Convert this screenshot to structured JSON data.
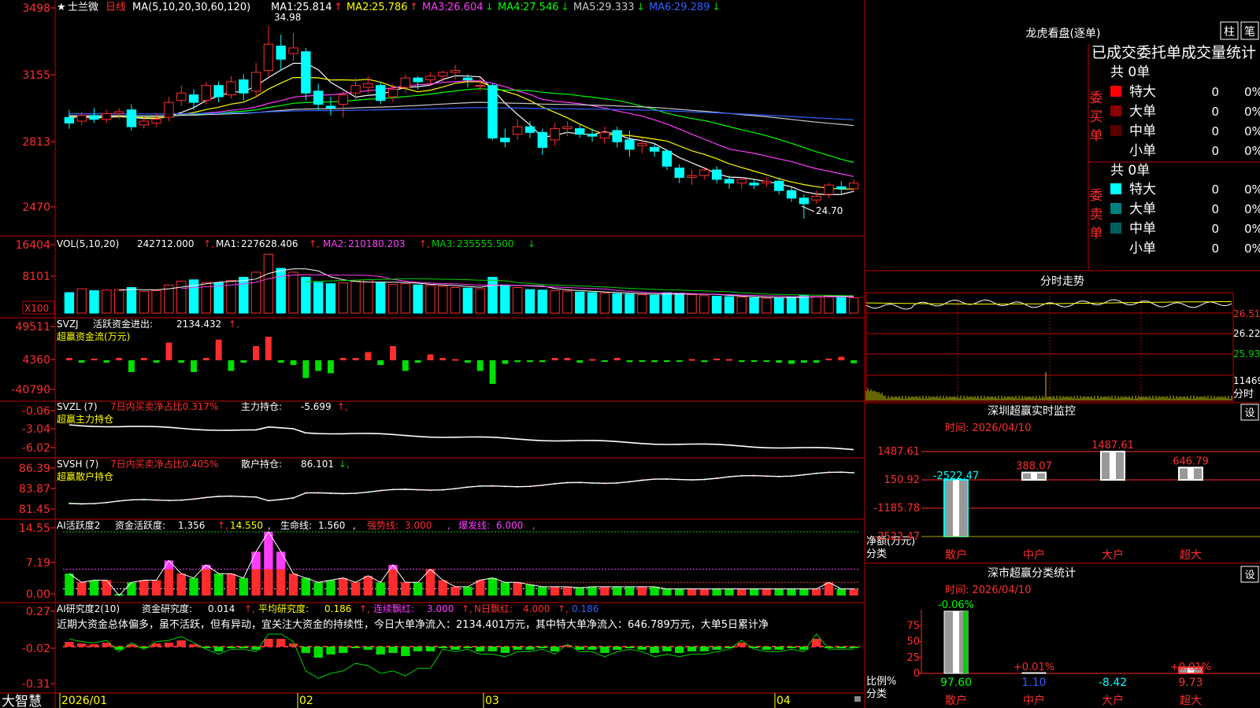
{
  "stock": {
    "name": "士兰微",
    "period": "日线",
    "star": "★",
    "app": "大智慧"
  },
  "colors": {
    "up": "#ff2d2d",
    "down": "#00ffff",
    "bg": "#000000",
    "grid": "#c00000",
    "yellow": "#ffff00",
    "magenta": "#ff3cff",
    "green": "#00d000",
    "blue": "#2a5cff",
    "white": "#ffffff"
  },
  "main_panel": {
    "ma_params": "MA(5,10,20,30,60,120)",
    "ma_values": [
      {
        "label": "MA1:",
        "value": "25.814",
        "arrow": "↑",
        "color": "#ffffff"
      },
      {
        "label": "MA2:",
        "value": "25.786",
        "arrow": "↑",
        "color": "#ffff00"
      },
      {
        "label": "MA3:",
        "value": "26.604",
        "arrow": "↓",
        "color": "#ff3cff"
      },
      {
        "label": "MA4:",
        "value": "27.546",
        "arrow": "↓",
        "color": "#00ff00"
      },
      {
        "label": "MA5:",
        "value": "29.333",
        "arrow": "↓",
        "color": "#c8c8c8"
      },
      {
        "label": "MA6:",
        "value": "29.289",
        "arrow": "↓",
        "color": "#3060ff"
      }
    ],
    "y_ticks": [
      "3498",
      "3155",
      "2813",
      "2470"
    ],
    "high_label": "34.98",
    "low_label": "24.70"
  },
  "vol_panel": {
    "title": "VOL(5,10,20)",
    "value": "242712.000",
    "ma1": "227628.406",
    "ma2": "210180.203",
    "ma3": "235555.500",
    "y_ticks": [
      "16404",
      "8101"
    ],
    "unit": "X100"
  },
  "svzj_panel": {
    "title": "SVZJ",
    "label": "活跃资金进出:",
    "value": "2134.432",
    "subtitle": "超赢资金流(万元)",
    "y_ticks": [
      "49511",
      "4360",
      "-40790"
    ]
  },
  "svzl_panel": {
    "title": "SVZL (7)",
    "ratio_text": "7日内买卖净占比0.317%",
    "hold_label": "主力持仓:",
    "hold_value": "-5.699",
    "subtitle": "超赢主力持仓",
    "y_ticks": [
      "-0.06",
      "-3.04",
      "-6.02"
    ]
  },
  "svsh_panel": {
    "title": "SVSH (7)",
    "ratio_text": "7日内买卖净占比0.405%",
    "hold_label": "散户持仓:",
    "hold_value": "86.101",
    "subtitle": "超赢散户持仓",
    "y_ticks": [
      "86.39",
      "83.87",
      "81.45"
    ]
  },
  "ai_active_panel": {
    "title": "AI活跃度2",
    "label1": "资金活跃度:",
    "value1": "1.356",
    "value2": "14.550",
    "label3": "生命线:",
    "value3": "1.560",
    "label4": "强势线:",
    "value4": "3.000",
    "label5": "爆发线:",
    "value5": "6.000",
    "y_ticks": [
      "14.55",
      "7.19",
      "0.00"
    ]
  },
  "ai_research_panel": {
    "title": "AI研究度2(10)",
    "label1": "资金研究度:",
    "value1": "0.014",
    "label2": "平均研究度:",
    "value2": "0.186",
    "label3": "连续飘红:",
    "value3": "3.000",
    "label4": "N日飘红:",
    "value4": "4.000",
    "value5": "0.186",
    "comment": "近期大资金总体偏多，虽不活跃，但有异动，宜关注大资金的持续性，今日大单净流入：2134.401万元，其中特大单净流入：646.789万元，大单5日累计净",
    "y_ticks": [
      "0.27",
      "-0.02",
      "-0.31"
    ]
  },
  "x_axis": [
    "2026/01",
    "02",
    "03",
    "04"
  ],
  "lhb": {
    "title": "龙虎看盘(逐单)",
    "btn1": "柱",
    "btn2": "笔",
    "header": "已成交委托单成交量统计",
    "buy_label": "委买单",
    "sell_label": "委卖单",
    "buy_total": "共 0单",
    "sell_total": "共 0单",
    "buy_rows": [
      {
        "name": "特大",
        "count": "0",
        "pct": "0%"
      },
      {
        "name": "大单",
        "count": "0",
        "pct": "0%"
      },
      {
        "name": "中单",
        "count": "0",
        "pct": "0%"
      },
      {
        "name": "小单",
        "count": "0",
        "pct": "0%"
      }
    ],
    "sell_rows": [
      {
        "name": "特大",
        "count": "0",
        "pct": "0%"
      },
      {
        "name": "大单",
        "count": "0",
        "pct": "0%"
      },
      {
        "name": "中单",
        "count": "0",
        "pct": "0%"
      },
      {
        "name": "小单",
        "count": "0",
        "pct": "0%"
      }
    ]
  },
  "intraday": {
    "title": "分时走势",
    "prices": [
      "26.51",
      "26.22",
      "25.93"
    ],
    "vol_label": "11469",
    "tab": "分时"
  },
  "monitor": {
    "title": "深圳超赢实时监控",
    "setting": "设",
    "time_label": "时间: 2026/04/10",
    "y_ticks": [
      "1487.61",
      "150.92",
      "-1185.78",
      "-2522.47"
    ],
    "ylabel1": "净额(万元)",
    "ylabel2": "分类",
    "categories": [
      "散户",
      "中户",
      "大户",
      "超大"
    ],
    "values": [
      -2522.47,
      388.07,
      1487.61,
      646.79
    ],
    "value_labels": [
      "-2522.47",
      "388.07",
      "1487.61",
      "646.79"
    ]
  },
  "classify": {
    "title": "深市超赢分类统计",
    "setting": "设",
    "time_label": "时间: 2026/04/10",
    "y_ticks": [
      "75",
      "50",
      "25",
      "0"
    ],
    "ylabel1": "比例%",
    "ylabel2": "分类",
    "categories": [
      "散户",
      "中户",
      "大户",
      "超大"
    ],
    "top_labels": [
      "-0.06%",
      "+0.01%",
      "",
      "+0.01%"
    ],
    "bottom_labels": [
      "97.60",
      "1.10",
      "-8.42",
      "9.73"
    ],
    "values": [
      97.6,
      1.1,
      -8.42,
      9.73
    ]
  },
  "chart_data": [
    {
      "type": "candlestick",
      "title": "士兰微 日线",
      "ylim": [
        24.7,
        34.98
      ],
      "series": [
        {
          "name": "MA1",
          "values": [
            25.814
          ]
        },
        {
          "name": "MA2",
          "values": [
            25.786
          ]
        },
        {
          "name": "MA3",
          "values": [
            26.604
          ]
        },
        {
          "name": "MA4",
          "values": [
            27.546
          ]
        },
        {
          "name": "MA5",
          "values": [
            29.333
          ]
        },
        {
          "name": "MA6",
          "values": [
            29.289
          ]
        }
      ],
      "candles": [
        [
          30.1,
          29.8,
          30.5,
          29.5
        ],
        [
          29.9,
          30.2,
          30.4,
          29.7
        ],
        [
          30.2,
          30.0,
          30.6,
          29.8
        ],
        [
          30.0,
          30.3,
          30.5,
          29.8
        ],
        [
          30.3,
          30.4,
          30.6,
          30.0
        ],
        [
          30.5,
          29.6,
          30.8,
          29.4
        ],
        [
          29.7,
          29.9,
          30.1,
          29.5
        ],
        [
          29.8,
          30.0,
          30.3,
          29.6
        ],
        [
          30.1,
          30.9,
          31.2,
          29.9
        ],
        [
          31.0,
          31.4,
          31.8,
          30.7
        ],
        [
          31.3,
          30.9,
          31.6,
          30.5
        ],
        [
          31.0,
          31.8,
          32.0,
          30.8
        ],
        [
          31.8,
          31.2,
          32.0,
          30.9
        ],
        [
          31.3,
          32.0,
          32.3,
          31.1
        ],
        [
          32.1,
          31.4,
          32.4,
          31.0
        ],
        [
          31.5,
          32.5,
          33.0,
          31.2
        ],
        [
          32.6,
          34.0,
          34.98,
          32.3
        ],
        [
          33.9,
          33.2,
          34.5,
          32.6
        ],
        [
          33.5,
          33.8,
          34.6,
          33.1
        ],
        [
          33.6,
          31.4,
          33.8,
          31.0
        ],
        [
          31.5,
          30.8,
          31.9,
          30.5
        ],
        [
          30.7,
          30.6,
          31.2,
          30.2
        ],
        [
          30.8,
          31.3,
          31.5,
          30.1
        ],
        [
          31.4,
          31.8,
          32.2,
          31.0
        ],
        [
          31.7,
          31.9,
          32.3,
          31.4
        ],
        [
          31.8,
          31.0,
          32.0,
          30.8
        ],
        [
          31.2,
          31.6,
          31.9,
          30.9
        ],
        [
          31.7,
          32.2,
          32.4,
          31.4
        ],
        [
          32.2,
          32.0,
          32.3,
          31.6
        ],
        [
          32.1,
          32.3,
          32.5,
          31.8
        ],
        [
          32.3,
          32.5,
          32.6,
          32.0
        ],
        [
          32.5,
          32.6,
          32.9,
          32.1
        ],
        [
          32.2,
          32.1,
          32.4,
          31.7
        ],
        [
          31.8,
          31.8,
          32.2,
          31.5
        ],
        [
          31.8,
          29.0,
          31.9,
          28.9
        ],
        [
          29.0,
          28.8,
          29.5,
          28.5
        ],
        [
          29.2,
          29.6,
          30.0,
          28.9
        ],
        [
          29.6,
          29.3,
          29.9,
          29.0
        ],
        [
          29.3,
          28.5,
          29.5,
          28.1
        ],
        [
          28.9,
          29.5,
          29.8,
          28.6
        ],
        [
          29.5,
          29.6,
          29.9,
          29.1
        ],
        [
          29.5,
          29.2,
          29.7,
          29.0
        ],
        [
          29.2,
          29.1,
          29.5,
          28.8
        ],
        [
          29.0,
          29.3,
          29.6,
          28.7
        ],
        [
          29.4,
          28.8,
          29.6,
          28.5
        ],
        [
          28.9,
          28.4,
          29.4,
          28.0
        ],
        [
          28.6,
          28.7,
          29.0,
          28.2
        ],
        [
          28.5,
          28.3,
          28.7,
          28.0
        ],
        [
          28.3,
          27.5,
          28.4,
          27.3
        ],
        [
          27.4,
          26.9,
          27.6,
          26.6
        ],
        [
          26.9,
          27.0,
          27.3,
          26.5
        ],
        [
          27.0,
          27.3,
          27.4,
          26.8
        ],
        [
          27.3,
          26.8,
          27.5,
          26.6
        ],
        [
          26.8,
          26.6,
          27.0,
          26.3
        ],
        [
          26.6,
          26.8,
          26.9,
          26.3
        ],
        [
          26.6,
          26.5,
          26.8,
          26.3
        ],
        [
          26.6,
          26.7,
          26.9,
          26.4
        ],
        [
          26.7,
          26.2,
          26.9,
          26.0
        ],
        [
          26.2,
          25.8,
          26.4,
          25.6
        ],
        [
          25.8,
          25.5,
          26.0,
          24.7
        ],
        [
          25.7,
          25.9,
          26.2,
          25.5
        ],
        [
          26.0,
          26.5,
          26.6,
          25.8
        ],
        [
          26.4,
          26.3,
          26.7,
          26.0
        ],
        [
          26.3,
          26.6,
          26.8,
          26.1
        ]
      ]
    },
    {
      "type": "bar",
      "title": "深圳超赢实时监控",
      "categories": [
        "散户",
        "中户",
        "大户",
        "超大"
      ],
      "values": [
        -2522.47,
        388.07,
        1487.61,
        646.79
      ],
      "ylabel": "净额(万元)"
    },
    {
      "type": "bar",
      "title": "深市超赢分类统计",
      "categories": [
        "散户",
        "中户",
        "大户",
        "超大"
      ],
      "values": [
        97.6,
        1.1,
        -8.42,
        9.73
      ],
      "ylabel": "比例%"
    }
  ]
}
